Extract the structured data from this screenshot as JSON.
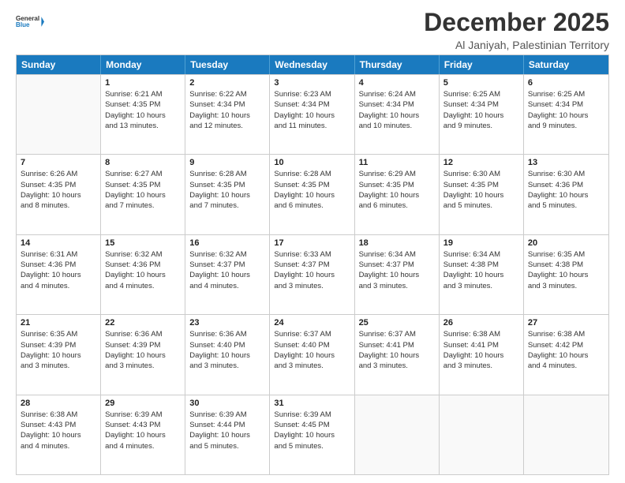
{
  "logo": {
    "line1": "General",
    "line2": "Blue"
  },
  "title": "December 2025",
  "subtitle": "Al Janiyah, Palestinian Territory",
  "header_days": [
    "Sunday",
    "Monday",
    "Tuesday",
    "Wednesday",
    "Thursday",
    "Friday",
    "Saturday"
  ],
  "weeks": [
    [
      {
        "day": "",
        "info": ""
      },
      {
        "day": "1",
        "info": "Sunrise: 6:21 AM\nSunset: 4:35 PM\nDaylight: 10 hours\nand 13 minutes."
      },
      {
        "day": "2",
        "info": "Sunrise: 6:22 AM\nSunset: 4:34 PM\nDaylight: 10 hours\nand 12 minutes."
      },
      {
        "day": "3",
        "info": "Sunrise: 6:23 AM\nSunset: 4:34 PM\nDaylight: 10 hours\nand 11 minutes."
      },
      {
        "day": "4",
        "info": "Sunrise: 6:24 AM\nSunset: 4:34 PM\nDaylight: 10 hours\nand 10 minutes."
      },
      {
        "day": "5",
        "info": "Sunrise: 6:25 AM\nSunset: 4:34 PM\nDaylight: 10 hours\nand 9 minutes."
      },
      {
        "day": "6",
        "info": "Sunrise: 6:25 AM\nSunset: 4:34 PM\nDaylight: 10 hours\nand 9 minutes."
      }
    ],
    [
      {
        "day": "7",
        "info": "Sunrise: 6:26 AM\nSunset: 4:35 PM\nDaylight: 10 hours\nand 8 minutes."
      },
      {
        "day": "8",
        "info": "Sunrise: 6:27 AM\nSunset: 4:35 PM\nDaylight: 10 hours\nand 7 minutes."
      },
      {
        "day": "9",
        "info": "Sunrise: 6:28 AM\nSunset: 4:35 PM\nDaylight: 10 hours\nand 7 minutes."
      },
      {
        "day": "10",
        "info": "Sunrise: 6:28 AM\nSunset: 4:35 PM\nDaylight: 10 hours\nand 6 minutes."
      },
      {
        "day": "11",
        "info": "Sunrise: 6:29 AM\nSunset: 4:35 PM\nDaylight: 10 hours\nand 6 minutes."
      },
      {
        "day": "12",
        "info": "Sunrise: 6:30 AM\nSunset: 4:35 PM\nDaylight: 10 hours\nand 5 minutes."
      },
      {
        "day": "13",
        "info": "Sunrise: 6:30 AM\nSunset: 4:36 PM\nDaylight: 10 hours\nand 5 minutes."
      }
    ],
    [
      {
        "day": "14",
        "info": "Sunrise: 6:31 AM\nSunset: 4:36 PM\nDaylight: 10 hours\nand 4 minutes."
      },
      {
        "day": "15",
        "info": "Sunrise: 6:32 AM\nSunset: 4:36 PM\nDaylight: 10 hours\nand 4 minutes."
      },
      {
        "day": "16",
        "info": "Sunrise: 6:32 AM\nSunset: 4:37 PM\nDaylight: 10 hours\nand 4 minutes."
      },
      {
        "day": "17",
        "info": "Sunrise: 6:33 AM\nSunset: 4:37 PM\nDaylight: 10 hours\nand 3 minutes."
      },
      {
        "day": "18",
        "info": "Sunrise: 6:34 AM\nSunset: 4:37 PM\nDaylight: 10 hours\nand 3 minutes."
      },
      {
        "day": "19",
        "info": "Sunrise: 6:34 AM\nSunset: 4:38 PM\nDaylight: 10 hours\nand 3 minutes."
      },
      {
        "day": "20",
        "info": "Sunrise: 6:35 AM\nSunset: 4:38 PM\nDaylight: 10 hours\nand 3 minutes."
      }
    ],
    [
      {
        "day": "21",
        "info": "Sunrise: 6:35 AM\nSunset: 4:39 PM\nDaylight: 10 hours\nand 3 minutes."
      },
      {
        "day": "22",
        "info": "Sunrise: 6:36 AM\nSunset: 4:39 PM\nDaylight: 10 hours\nand 3 minutes."
      },
      {
        "day": "23",
        "info": "Sunrise: 6:36 AM\nSunset: 4:40 PM\nDaylight: 10 hours\nand 3 minutes."
      },
      {
        "day": "24",
        "info": "Sunrise: 6:37 AM\nSunset: 4:40 PM\nDaylight: 10 hours\nand 3 minutes."
      },
      {
        "day": "25",
        "info": "Sunrise: 6:37 AM\nSunset: 4:41 PM\nDaylight: 10 hours\nand 3 minutes."
      },
      {
        "day": "26",
        "info": "Sunrise: 6:38 AM\nSunset: 4:41 PM\nDaylight: 10 hours\nand 3 minutes."
      },
      {
        "day": "27",
        "info": "Sunrise: 6:38 AM\nSunset: 4:42 PM\nDaylight: 10 hours\nand 4 minutes."
      }
    ],
    [
      {
        "day": "28",
        "info": "Sunrise: 6:38 AM\nSunset: 4:43 PM\nDaylight: 10 hours\nand 4 minutes."
      },
      {
        "day": "29",
        "info": "Sunrise: 6:39 AM\nSunset: 4:43 PM\nDaylight: 10 hours\nand 4 minutes."
      },
      {
        "day": "30",
        "info": "Sunrise: 6:39 AM\nSunset: 4:44 PM\nDaylight: 10 hours\nand 5 minutes."
      },
      {
        "day": "31",
        "info": "Sunrise: 6:39 AM\nSunset: 4:45 PM\nDaylight: 10 hours\nand 5 minutes."
      },
      {
        "day": "",
        "info": ""
      },
      {
        "day": "",
        "info": ""
      },
      {
        "day": "",
        "info": ""
      }
    ]
  ]
}
